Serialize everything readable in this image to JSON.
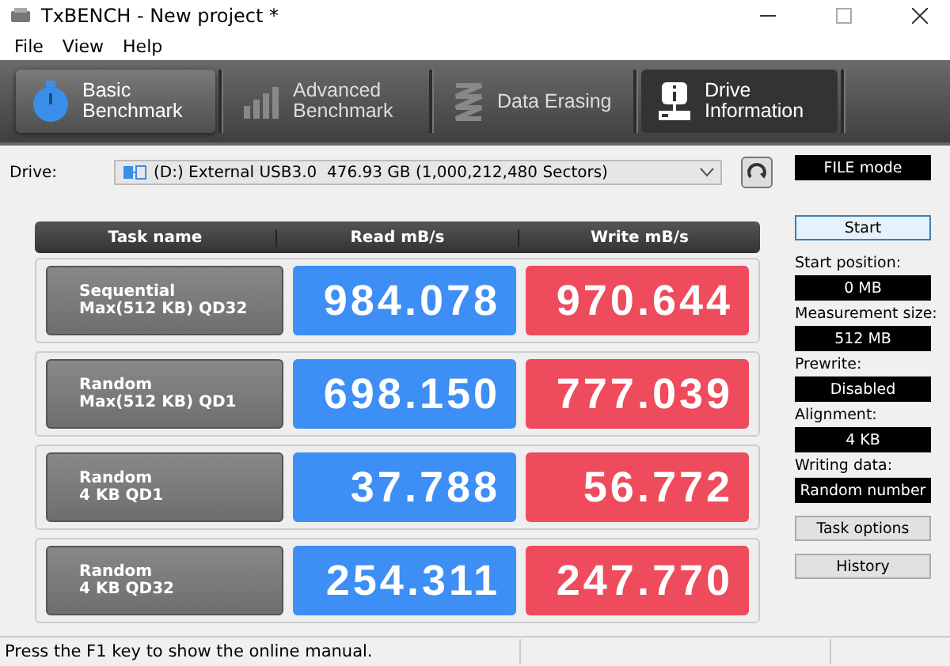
{
  "window": {
    "title": "TxBENCH - New project *"
  },
  "menu": [
    "File",
    "View",
    "Help"
  ],
  "tabs": [
    {
      "label": "Basic Benchmark",
      "kind": "stopwatch",
      "selected": true,
      "highlighted": false
    },
    {
      "label": "Advanced Benchmark",
      "kind": "bars",
      "selected": false,
      "highlighted": false
    },
    {
      "label": "Data Erasing",
      "kind": "erase",
      "selected": false,
      "highlighted": false
    },
    {
      "label": "Drive Information",
      "kind": "info",
      "selected": false,
      "highlighted": true
    }
  ],
  "drive": {
    "label": "Drive:",
    "value": "(D:) External USB3.0  476.93 GB (1,000,212,480 Sectors)",
    "mode": "FILE mode"
  },
  "table": {
    "columns": [
      "Task name",
      "Read mB/s",
      "Write mB/s"
    ],
    "rows": [
      {
        "line1": "Sequential",
        "line2": "Max(512 KB) QD32",
        "read": "984.078",
        "write": "970.644"
      },
      {
        "line1": "Random",
        "line2": "Max(512 KB) QD1",
        "read": "698.150",
        "write": "777.039"
      },
      {
        "line1": "Random",
        "line2": "4 KB QD1",
        "read": "37.788",
        "write": "56.772"
      },
      {
        "line1": "Random",
        "line2": "4 KB QD32",
        "read": "254.311",
        "write": "247.770"
      }
    ]
  },
  "side": {
    "start": "Start",
    "settings": [
      {
        "label": "Start position:",
        "value": "0 MB"
      },
      {
        "label": "Measurement size:",
        "value": "512 MB"
      },
      {
        "label": "Prewrite:",
        "value": "Disabled"
      },
      {
        "label": "Alignment:",
        "value": "4 KB"
      },
      {
        "label": "Writing data:",
        "value": "Random number"
      }
    ],
    "buttons": [
      "Task options",
      "History"
    ]
  },
  "status_bar": "Press the F1 key to show the online manual."
}
